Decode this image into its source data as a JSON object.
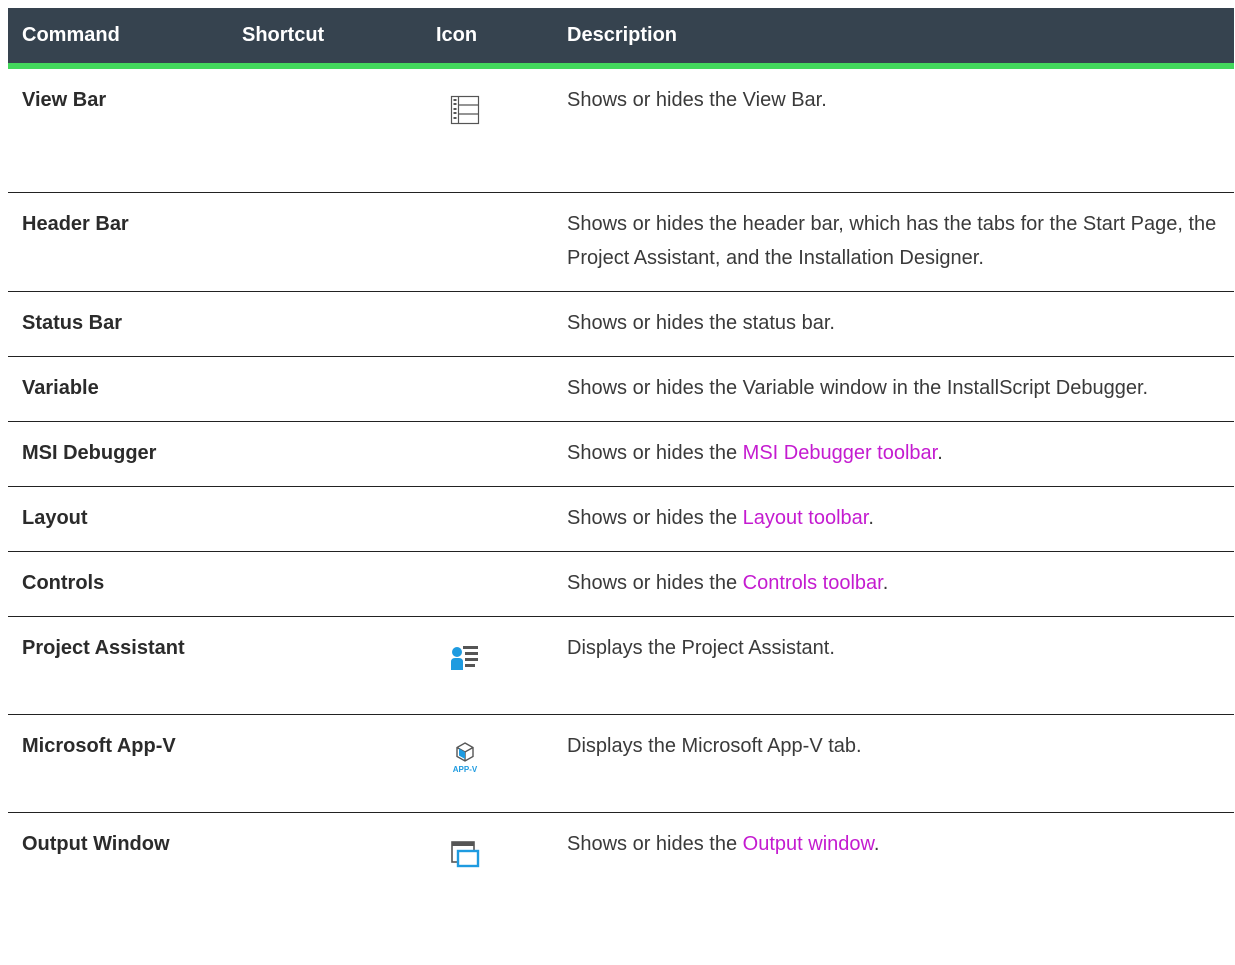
{
  "header": {
    "command": "Command",
    "shortcut": "Shortcut",
    "icon": "Icon",
    "description": "Description"
  },
  "rows": [
    {
      "command": "View Bar",
      "shortcut": "",
      "icon": "view-bar-icon",
      "desc_pre": "Shows or hides the View Bar.",
      "link": "",
      "desc_post": ""
    },
    {
      "command": "Header Bar",
      "shortcut": "",
      "icon": "",
      "desc_pre": "Shows or hides the header bar, which has the tabs for the Start Page, the Project Assistant, and the Installation Designer.",
      "link": "",
      "desc_post": ""
    },
    {
      "command": "Status Bar",
      "shortcut": "",
      "icon": "",
      "desc_pre": "Shows or hides the status bar.",
      "link": "",
      "desc_post": ""
    },
    {
      "command": "Variable",
      "shortcut": "",
      "icon": "",
      "desc_pre": "Shows or hides the Variable window in the InstallScript Debugger.",
      "link": "",
      "desc_post": ""
    },
    {
      "command": "MSI Debugger",
      "shortcut": "",
      "icon": "",
      "desc_pre": "Shows or hides the ",
      "link": "MSI Debugger toolbar",
      "desc_post": "."
    },
    {
      "command": "Layout",
      "shortcut": "",
      "icon": "",
      "desc_pre": "Shows or hides the ",
      "link": "Layout toolbar",
      "desc_post": "."
    },
    {
      "command": "Controls",
      "shortcut": "",
      "icon": "",
      "desc_pre": "Shows or hides the ",
      "link": "Controls toolbar",
      "desc_post": "."
    },
    {
      "command": "Project Assistant",
      "shortcut": "",
      "icon": "project-assistant-icon",
      "desc_pre": "Displays the Project Assistant.",
      "link": "",
      "desc_post": ""
    },
    {
      "command": "Microsoft App-V",
      "shortcut": "",
      "icon": "app-v-icon",
      "icon_text": "APP-V",
      "desc_pre": "Displays the Microsoft App-V tab.",
      "link": "",
      "desc_post": ""
    },
    {
      "command": "Output Window",
      "shortcut": "",
      "icon": "output-window-icon",
      "desc_pre": "Shows or hides the ",
      "link": "Output window",
      "desc_post": "."
    }
  ],
  "colors": {
    "header_bg": "#36434f",
    "header_accent": "#43d75c",
    "link": "#c41bd0",
    "icon_blue": "#1e9be0"
  }
}
